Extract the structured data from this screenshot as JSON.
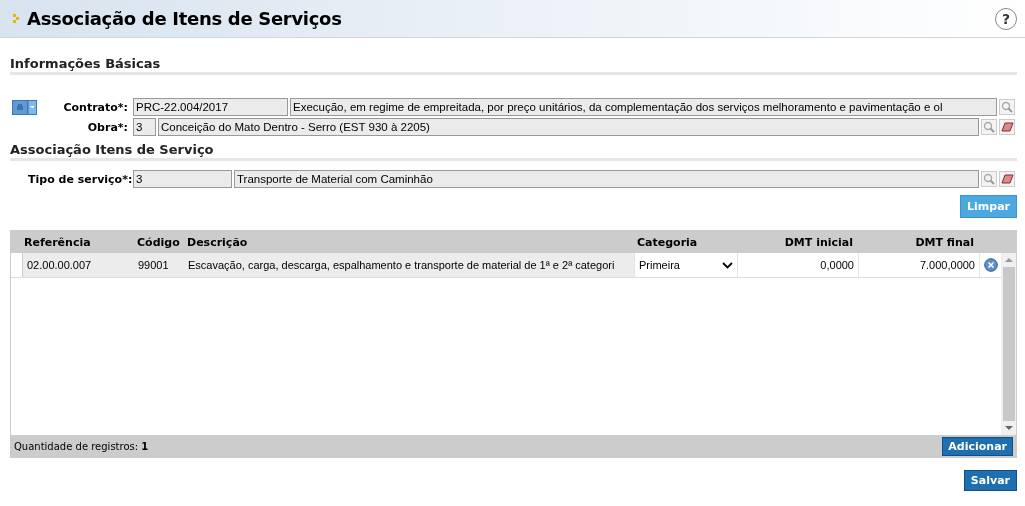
{
  "page": {
    "title": "Associação de Itens de Serviços",
    "help": "?"
  },
  "basic_info": {
    "title": "Informações Básicas",
    "fields": [
      {
        "label": "Contrato*:",
        "code": "PRC-22.004/2017",
        "description": "Execução, em regime de empreitada, por preço unitários, da complementação dos serviços melhoramento e pavimentação e ol",
        "clearable": false
      },
      {
        "label": "Obra*:",
        "code": "3",
        "description": "Conceição do Mato Dentro - Serro (EST 930 à 2205)",
        "clearable": true
      }
    ]
  },
  "service_items": {
    "title": "Associação Itens de Serviço",
    "fields": [
      {
        "label": "Tipo de serviço*:",
        "code": "3",
        "description": "Transporte  de Material com Caminhão",
        "clearable": true
      }
    ],
    "clear_button": "Limpar"
  },
  "table": {
    "columns": [
      "Referência",
      "Código",
      "Descrição",
      "Categoria",
      "DMT inicial",
      "DMT final"
    ],
    "rows": [
      {
        "reference": "02.00.00.007",
        "code": "99001",
        "description": "Escavação, carga, descarga, espalhamento e transporte de material de 1ª e 2ª categori",
        "category": "Primeira",
        "dmt_initial": "0,0000",
        "dmt_final": "7.000,0000"
      }
    ],
    "record_count": "Quantidade de registros: **1**",
    "add_button": "Adicionar"
  },
  "save_button": "Salvar"
}
